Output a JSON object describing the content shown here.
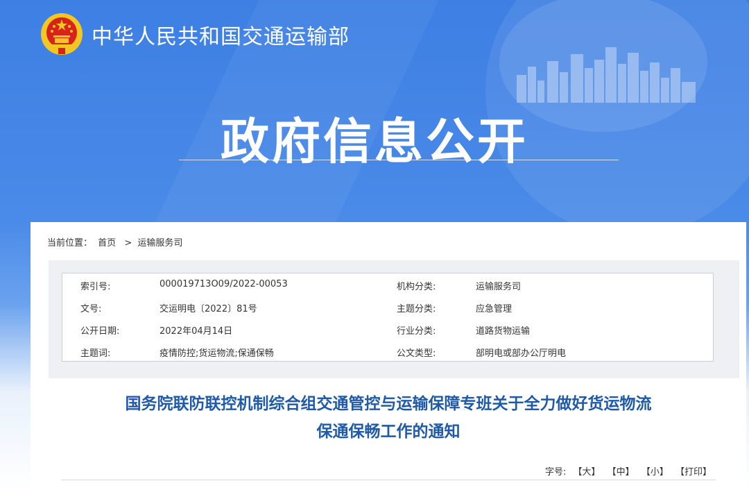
{
  "header": {
    "site_name": "中华人民共和国交通运输部",
    "section_title": "政府信息公开"
  },
  "breadcrumb": {
    "prefix": "当前位置：",
    "items": [
      "首页",
      "运输服务司"
    ],
    "separator": ">"
  },
  "meta": {
    "left": [
      {
        "label": "索引号:",
        "value": "000019713O09/2022-00053"
      },
      {
        "label": "文号:",
        "value": "交运明电〔2022〕81号"
      },
      {
        "label": "公开日期:",
        "value": "2022年04月14日"
      },
      {
        "label": "主题词:",
        "value": "疫情防控;货运物流;保通保畅"
      }
    ],
    "right": [
      {
        "label": "机构分类:",
        "value": "运输服务司"
      },
      {
        "label": "主题分类:",
        "value": "应急管理"
      },
      {
        "label": "行业分类:",
        "value": "道路货物运输"
      },
      {
        "label": "公文类型:",
        "value": "部明电或部办公厅明电"
      }
    ]
  },
  "document": {
    "title_line1": "国务院联防联控机制综合组交通管控与运输保障专班关于全力做好货运物流",
    "title_line2": "保通保畅工作的通知"
  },
  "font_size": {
    "label": "字号:",
    "large": "【大】",
    "medium": "【中】",
    "small": "【小】",
    "print": "【打印】"
  },
  "colors": {
    "header_blue": "#3d7fe3",
    "title_blue": "#1e5aa8",
    "emblem_red": "#d6231b",
    "emblem_gold": "#f3c623"
  }
}
